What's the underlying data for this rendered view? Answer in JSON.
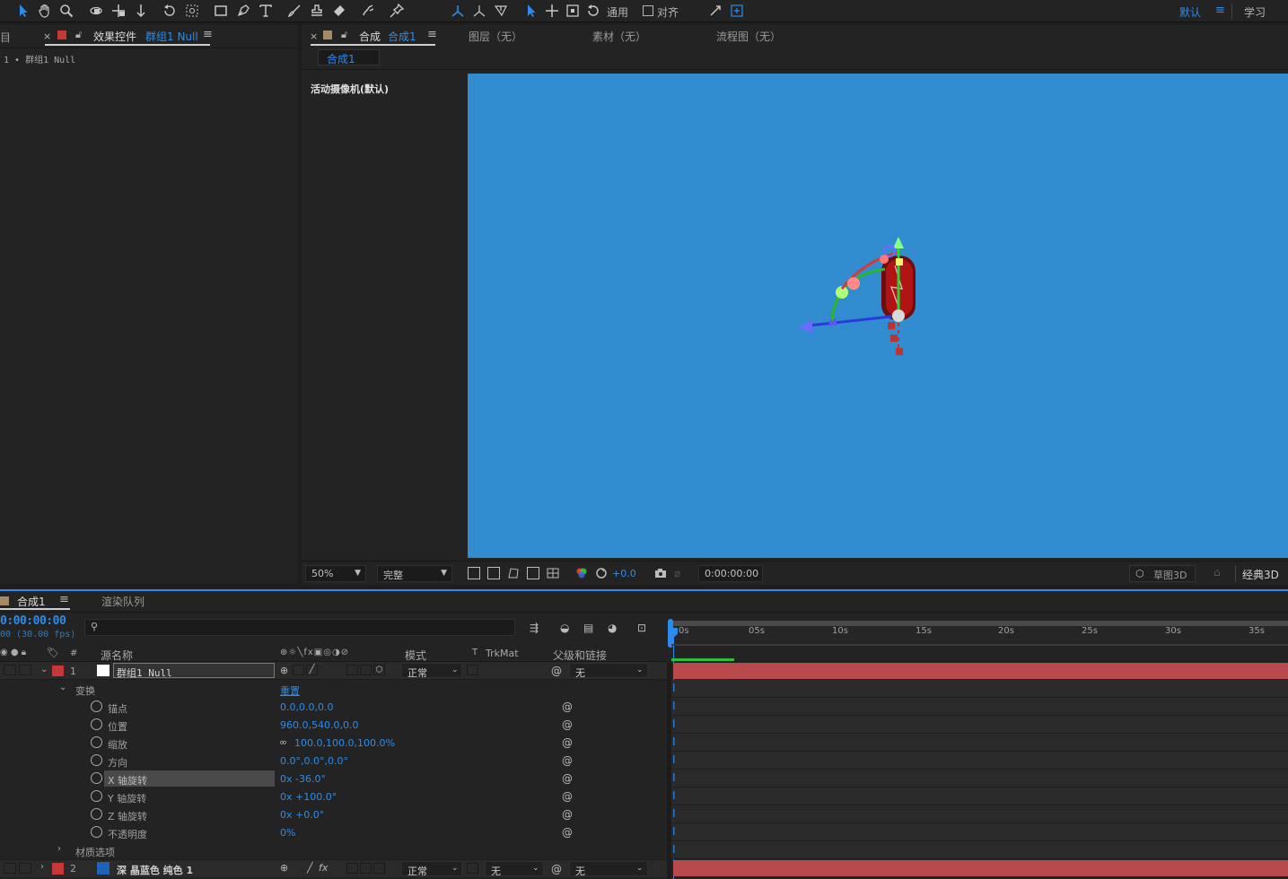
{
  "toolbar": {
    "general_label": "通用",
    "align_label": "对齐",
    "workspace_default": "默认",
    "workspace_learn": "学习"
  },
  "project_panel": {
    "stub_label": "目",
    "tab_close": "×",
    "tab_title": "效果控件",
    "tab_target": "群组1 Null",
    "breadcrumb": "1 • 群组1 Null"
  },
  "viewer_tabs": {
    "comp_close": "×",
    "comp_title": "合成",
    "comp_name": "合成1",
    "layer_tab": "图层（无）",
    "footage_tab": "素材（无）",
    "flowchart_tab": "流程图（无）",
    "subtab": "合成1",
    "camera_label": "活动摄像机(默认)"
  },
  "viewer_bar": {
    "zoom": "50%",
    "quality": "完整",
    "exposure": "+0.0",
    "timecode": "0:00:00:00",
    "renderer": "草图3D",
    "classic": "经典3D"
  },
  "timeline": {
    "tab_comp": "合成1",
    "tab_render": "渲染队列",
    "timecode": "0:00:00:00",
    "fps": "00 (30.00 fps)",
    "search_placeholder": "",
    "col_source": "源名称",
    "col_mode": "模式",
    "col_t": "T",
    "col_trkmat": "TrkMat",
    "col_parent": "父级和链接",
    "ruler": [
      "0s",
      "05s",
      "10s",
      "15s",
      "20s",
      "25s",
      "30s",
      "35s"
    ],
    "layers": [
      {
        "num": "1",
        "name": "群组1 Null",
        "mode": "正常",
        "parent": "无",
        "label_color": "#c43838",
        "swatch": "#ffffff"
      },
      {
        "num": "2",
        "name": "深 晶蓝色 纯色 1",
        "mode": "正常",
        "trkmat": "无",
        "parent": "无",
        "label_color": "#c43838",
        "swatch": "#1e63b8"
      }
    ],
    "transform_label": "变换",
    "reset_label": "重置",
    "props": [
      {
        "name": "锚点",
        "value": "0.0,0.0,0.0"
      },
      {
        "name": "位置",
        "value": "960.0,540.0,0.0"
      },
      {
        "name": "缩放",
        "value": "100.0,100.0,100.0%"
      },
      {
        "name": "方向",
        "value": "0.0°,0.0°,0.0°"
      },
      {
        "name": "X 轴旋转",
        "value": "0x -36.0°"
      },
      {
        "name": "Y 轴旋转",
        "value": "0x +100.0°"
      },
      {
        "name": "Z 轴旋转",
        "value": "0x +0.0°"
      },
      {
        "name": "不透明度",
        "value": "0%"
      }
    ],
    "material_label": "材质选项"
  },
  "colors": {
    "accent": "#2d8ceb",
    "comp_bg": "#318dcf",
    "track_red": "#b84a4e"
  }
}
